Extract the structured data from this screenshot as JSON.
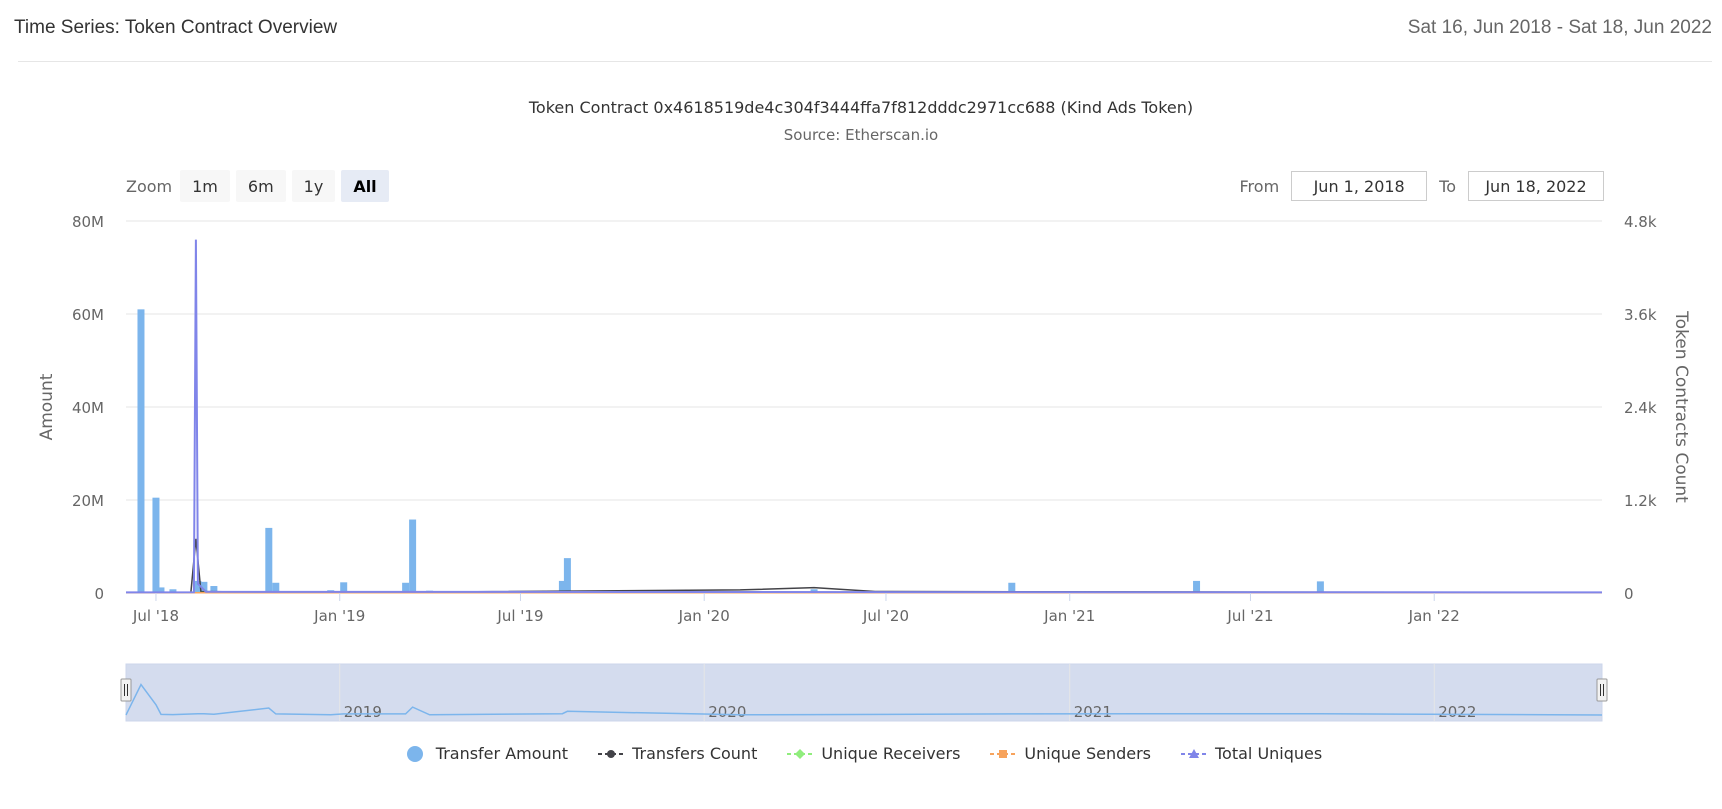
{
  "header": {
    "title": "Time Series: Token Contract Overview",
    "date_range": "Sat 16, Jun 2018 - Sat 18, Jun 2022"
  },
  "zoom": {
    "label": "Zoom",
    "buttons": [
      "1m",
      "6m",
      "1y",
      "All"
    ],
    "active": "All"
  },
  "range": {
    "from_label": "From",
    "from_value": "Jun 1, 2018",
    "to_label": "To",
    "to_value": "Jun 18, 2022"
  },
  "colors": {
    "transfer_amount": "#7cb5ec",
    "transfers_count": "#434348",
    "unique_receivers": "#90ed7d",
    "unique_senders": "#f7a35c",
    "total_uniques": "#8085e9",
    "navigator_fill": "#ccd6eb",
    "navigator_line": "#7cb5ec"
  },
  "chart_data": {
    "type": "bar",
    "title": "Token Contract 0x4618519de4c304f3444ffa7f812dddc2971cc688 (Kind Ads Token)",
    "subtitle": "Source: Etherscan.io",
    "x_range": [
      "2018-06-01",
      "2022-06-18"
    ],
    "x_ticks": [
      "Jul '18",
      "Jan '19",
      "Jul '19",
      "Jan '20",
      "Jul '20",
      "Jan '21",
      "Jul '21",
      "Jan '22"
    ],
    "y_left": {
      "label": "Amount",
      "ylim": [
        0,
        80000000
      ],
      "ticks": [
        "0",
        "20M",
        "40M",
        "60M",
        "80M"
      ]
    },
    "y_right": {
      "label": "Token Contracts Count",
      "ylim": [
        0,
        4800
      ],
      "ticks": [
        "0",
        "1.2k",
        "2.4k",
        "3.6k",
        "4.8k"
      ]
    },
    "grid": true,
    "legend_position": "bottom-center",
    "series": [
      {
        "name": "Transfer Amount",
        "axis": "left",
        "type": "column",
        "points": [
          [
            "2018-06-16",
            61000000
          ],
          [
            "2018-07-01",
            20500000
          ],
          [
            "2018-07-06",
            1200000
          ],
          [
            "2018-07-18",
            800000
          ],
          [
            "2018-08-12",
            2600000
          ],
          [
            "2018-08-18",
            2400000
          ],
          [
            "2018-08-28",
            1500000
          ],
          [
            "2018-10-22",
            14000000
          ],
          [
            "2018-10-29",
            2200000
          ],
          [
            "2018-12-23",
            600000
          ],
          [
            "2019-01-05",
            2300000
          ],
          [
            "2019-03-08",
            2200000
          ],
          [
            "2019-03-15",
            15800000
          ],
          [
            "2019-04-01",
            500000
          ],
          [
            "2019-08-12",
            2600000
          ],
          [
            "2019-08-17",
            7500000
          ],
          [
            "2020-02-06",
            400000
          ],
          [
            "2020-04-20",
            800000
          ],
          [
            "2020-11-04",
            2200000
          ],
          [
            "2021-05-08",
            2600000
          ],
          [
            "2021-09-09",
            2500000
          ]
        ]
      },
      {
        "name": "Transfers Count",
        "axis": "right",
        "type": "line",
        "points": [
          [
            "2018-06-01",
            5
          ],
          [
            "2018-08-05",
            10
          ],
          [
            "2018-08-10",
            700
          ],
          [
            "2018-08-15",
            20
          ],
          [
            "2018-11-01",
            8
          ],
          [
            "2019-03-15",
            10
          ],
          [
            "2020-02-06",
            40
          ],
          [
            "2020-04-20",
            70
          ],
          [
            "2020-06-20",
            20
          ],
          [
            "2022-06-18",
            5
          ]
        ]
      },
      {
        "name": "Unique Receivers",
        "axis": "right",
        "type": "line",
        "points": [
          [
            "2018-06-01",
            5
          ],
          [
            "2022-06-18",
            5
          ]
        ]
      },
      {
        "name": "Unique Senders",
        "axis": "right",
        "type": "line",
        "points": [
          [
            "2018-06-01",
            3
          ],
          [
            "2022-06-18",
            3
          ]
        ]
      },
      {
        "name": "Total Uniques",
        "axis": "right",
        "type": "line",
        "points": [
          [
            "2018-06-01",
            8
          ],
          [
            "2018-08-08",
            10
          ],
          [
            "2018-08-10",
            4560
          ],
          [
            "2018-08-12",
            120
          ],
          [
            "2018-08-20",
            15
          ],
          [
            "2022-06-18",
            8
          ]
        ]
      }
    ],
    "navigator": {
      "x_labels": [
        "2019",
        "2020",
        "2021",
        "2022"
      ]
    }
  }
}
